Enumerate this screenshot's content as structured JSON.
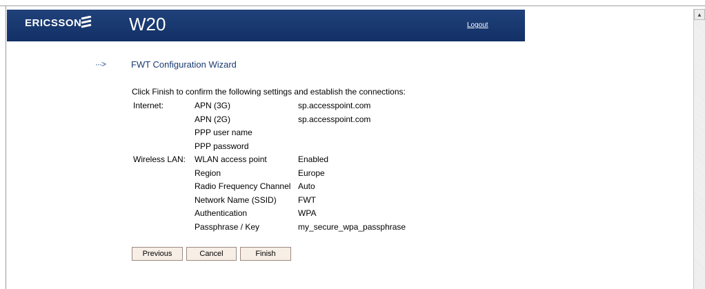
{
  "header": {
    "brand": "ERICSSON",
    "model": "W20",
    "logout_label": "Logout"
  },
  "wizard": {
    "arrow": "···>",
    "title": "FWT Configuration Wizard",
    "intro": "Click Finish to confirm the following settings and establish the connections:",
    "rows": [
      {
        "section": "Internet:",
        "label": "APN (3G)",
        "value": "sp.accesspoint.com"
      },
      {
        "section": "",
        "label": "APN (2G)",
        "value": "sp.accesspoint.com"
      },
      {
        "section": "",
        "label": "PPP user name",
        "value": ""
      },
      {
        "section": "",
        "label": "PPP password",
        "value": ""
      },
      {
        "section": "Wireless LAN:",
        "label": "WLAN access point",
        "value": "Enabled"
      },
      {
        "section": "",
        "label": "Region",
        "value": "Europe"
      },
      {
        "section": "",
        "label": "Radio Frequency Channel",
        "value": "Auto"
      },
      {
        "section": "",
        "label": "Network Name (SSID)",
        "value": "FWT"
      },
      {
        "section": "",
        "label": "Authentication",
        "value": "WPA"
      },
      {
        "section": "",
        "label": "Passphrase / Key",
        "value": "my_secure_wpa_passphrase"
      }
    ]
  },
  "buttons": {
    "previous": "Previous",
    "cancel": "Cancel",
    "finish": "Finish"
  },
  "colors": {
    "banner": "#1a3a72",
    "title": "#1a3a70"
  }
}
